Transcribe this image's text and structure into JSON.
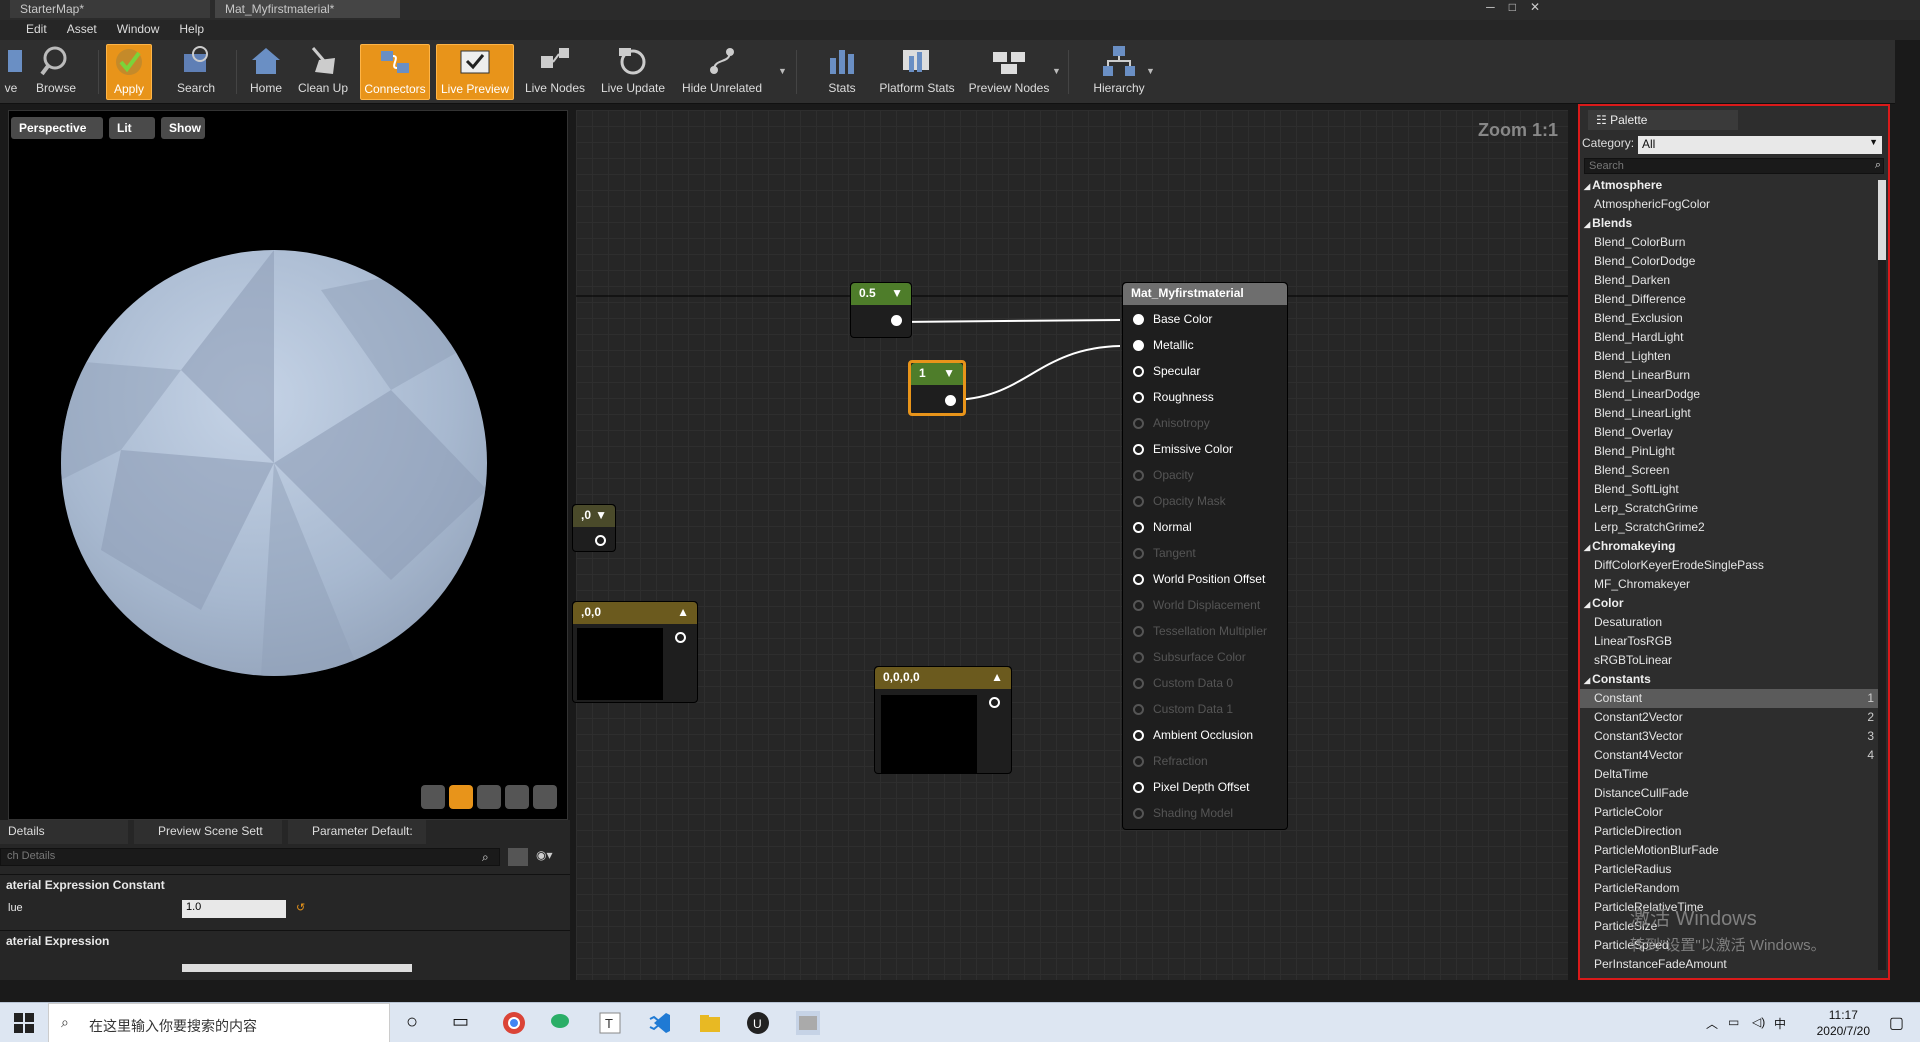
{
  "titlebar": {
    "tabs": [
      "StarterMap*",
      "Mat_Myfirstmaterial*"
    ]
  },
  "menu": [
    "Edit",
    "Asset",
    "Window",
    "Help"
  ],
  "toolbar": {
    "items": [
      "ve",
      "Browse",
      "Apply",
      "Search",
      "Home",
      "Clean Up",
      "Connectors",
      "Live Preview",
      "Live Nodes",
      "Live Update",
      "Hide Unrelated",
      "Stats",
      "Platform Stats",
      "Preview Nodes",
      "Hierarchy"
    ]
  },
  "viewport": {
    "buttons": [
      "Perspective",
      "Lit",
      "Show"
    ]
  },
  "details": {
    "tabs": [
      "Details",
      "Preview Scene Sett",
      "Parameter Default:"
    ],
    "search_placeholder": "ch Details",
    "section1": "aterial Expression Constant",
    "value_label": "lue",
    "value": "1.0",
    "section2": "aterial Expression"
  },
  "graph": {
    "zoom": "Zoom 1:1",
    "node_a": "0.5",
    "node_b": "1",
    "node_c": ",0",
    "node_d": ",0,0",
    "node_e": "0,0,0,0",
    "material": {
      "title": "Mat_Myfirstmaterial",
      "pins": [
        {
          "label": "Base Color",
          "enabled": true,
          "connected": true
        },
        {
          "label": "Metallic",
          "enabled": true,
          "connected": true
        },
        {
          "label": "Specular",
          "enabled": true,
          "connected": false
        },
        {
          "label": "Roughness",
          "enabled": true,
          "connected": false
        },
        {
          "label": "Anisotropy",
          "enabled": false,
          "connected": false
        },
        {
          "label": "Emissive Color",
          "enabled": true,
          "connected": false
        },
        {
          "label": "Opacity",
          "enabled": false,
          "connected": false
        },
        {
          "label": "Opacity Mask",
          "enabled": false,
          "connected": false
        },
        {
          "label": "Normal",
          "enabled": true,
          "connected": false
        },
        {
          "label": "Tangent",
          "enabled": false,
          "connected": false
        },
        {
          "label": "World Position Offset",
          "enabled": true,
          "connected": false
        },
        {
          "label": "World Displacement",
          "enabled": false,
          "connected": false
        },
        {
          "label": "Tessellation Multiplier",
          "enabled": false,
          "connected": false
        },
        {
          "label": "Subsurface Color",
          "enabled": false,
          "connected": false
        },
        {
          "label": "Custom Data 0",
          "enabled": false,
          "connected": false
        },
        {
          "label": "Custom Data 1",
          "enabled": false,
          "connected": false
        },
        {
          "label": "Ambient Occlusion",
          "enabled": true,
          "connected": false
        },
        {
          "label": "Refraction",
          "enabled": false,
          "connected": false
        },
        {
          "label": "Pixel Depth Offset",
          "enabled": true,
          "connected": false
        },
        {
          "label": "Shading Model",
          "enabled": false,
          "connected": false
        }
      ]
    }
  },
  "palette": {
    "tab": "Palette",
    "category_label": "Category:",
    "category_value": "All",
    "search_placeholder": "Search",
    "items": [
      {
        "t": "Atmosphere",
        "cat": true
      },
      {
        "t": "AtmosphericFogColor"
      },
      {
        "t": "Blends",
        "cat": true
      },
      {
        "t": "Blend_ColorBurn"
      },
      {
        "t": "Blend_ColorDodge"
      },
      {
        "t": "Blend_Darken"
      },
      {
        "t": "Blend_Difference"
      },
      {
        "t": "Blend_Exclusion"
      },
      {
        "t": "Blend_HardLight"
      },
      {
        "t": "Blend_Lighten"
      },
      {
        "t": "Blend_LinearBurn"
      },
      {
        "t": "Blend_LinearDodge"
      },
      {
        "t": "Blend_LinearLight"
      },
      {
        "t": "Blend_Overlay"
      },
      {
        "t": "Blend_PinLight"
      },
      {
        "t": "Blend_Screen"
      },
      {
        "t": "Blend_SoftLight"
      },
      {
        "t": "Lerp_ScratchGrime"
      },
      {
        "t": "Lerp_ScratchGrime2"
      },
      {
        "t": "Chromakeying",
        "cat": true
      },
      {
        "t": "DiffColorKeyerErodeSinglePass"
      },
      {
        "t": "MF_Chromakeyer"
      },
      {
        "t": "Color",
        "cat": true
      },
      {
        "t": "Desaturation"
      },
      {
        "t": "LinearTosRGB"
      },
      {
        "t": "sRGBToLinear"
      },
      {
        "t": "Constants",
        "cat": true
      },
      {
        "t": "Constant",
        "sc": "1",
        "sel": true
      },
      {
        "t": "Constant2Vector",
        "sc": "2"
      },
      {
        "t": "Constant3Vector",
        "sc": "3"
      },
      {
        "t": "Constant4Vector",
        "sc": "4"
      },
      {
        "t": "DeltaTime"
      },
      {
        "t": "DistanceCullFade"
      },
      {
        "t": "ParticleColor"
      },
      {
        "t": "ParticleDirection"
      },
      {
        "t": "ParticleMotionBlurFade"
      },
      {
        "t": "ParticleRadius"
      },
      {
        "t": "ParticleRandom"
      },
      {
        "t": "ParticleRelativeTime"
      },
      {
        "t": "ParticleSize"
      },
      {
        "t": "ParticleSpeed"
      },
      {
        "t": "PerInstanceFadeAmount"
      }
    ]
  },
  "watermark": {
    "line1": "激活 Windows",
    "line2": "转到\"设置\"以激活 Windows。"
  },
  "taskbar": {
    "search": "在这里输入你要搜索的内容",
    "time": "11:17",
    "date": "2020/7/20",
    "ime": "中"
  }
}
